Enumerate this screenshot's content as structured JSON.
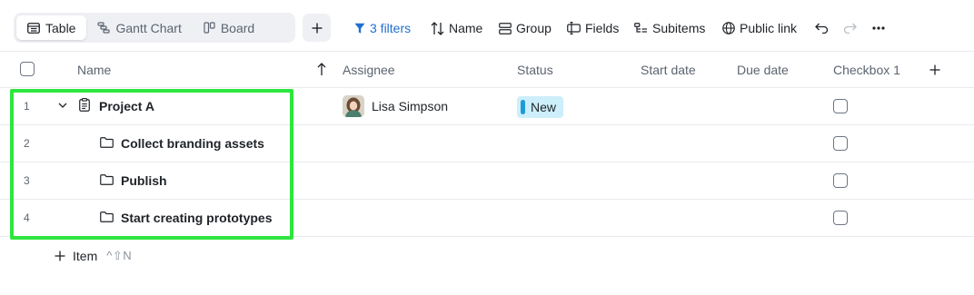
{
  "views": {
    "tabs": [
      {
        "label": "Table",
        "icon": "table-icon",
        "active": true
      },
      {
        "label": "Gantt Chart",
        "icon": "gantt-icon",
        "active": false
      },
      {
        "label": "Board",
        "icon": "board-icon",
        "active": false
      }
    ],
    "add_icon": "plus-icon"
  },
  "toolbar": {
    "filters_label": "3 filters",
    "sort_label": "Name",
    "group_label": "Group",
    "fields_label": "Fields",
    "subitems_label": "Subitems",
    "public_link_label": "Public link",
    "accent_color": "#1f6fd1"
  },
  "table": {
    "columns": {
      "name": "Name",
      "assignee": "Assignee",
      "status": "Status",
      "start_date": "Start date",
      "due_date": "Due date",
      "checkbox": "Checkbox 1"
    },
    "rows": [
      {
        "num": "1",
        "title": "Project A",
        "assignee": "Lisa Simpson",
        "status": "New",
        "expanded": true
      },
      {
        "num": "2",
        "title": "Collect branding assets"
      },
      {
        "num": "3",
        "title": "Publish"
      },
      {
        "num": "4",
        "title": "Start creating prototypes"
      }
    ],
    "status_color": "#cdeefb",
    "highlight_color": "#2ee63d"
  },
  "add_item": {
    "label": "Item",
    "shortcut": "^⇧N"
  }
}
